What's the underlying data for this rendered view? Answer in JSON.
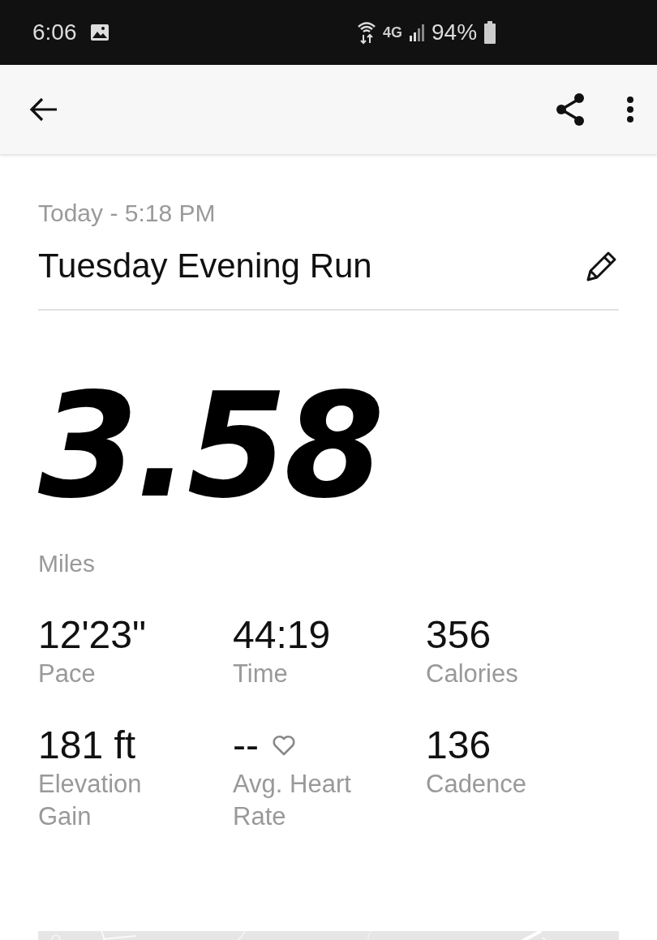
{
  "status_bar": {
    "time": "6:06",
    "network": "4G",
    "battery": "94%"
  },
  "activity": {
    "date": "Today - 5:18 PM",
    "title": "Tuesday Evening Run",
    "distance": "3.58",
    "unit": "Miles"
  },
  "stats": [
    {
      "kind": "plain",
      "value": "12'23\"",
      "label": "Pace"
    },
    {
      "kind": "plain",
      "value": "44:19",
      "label": "Time"
    },
    {
      "kind": "plain",
      "value": "356",
      "label": "Calories"
    },
    {
      "kind": "plain",
      "value": "181 ft",
      "label": "Elevation Gain"
    },
    {
      "kind": "heart",
      "value": "--",
      "label": "Avg. Heart Rate"
    },
    {
      "kind": "plain",
      "value": "136",
      "label": "Cadence"
    }
  ]
}
